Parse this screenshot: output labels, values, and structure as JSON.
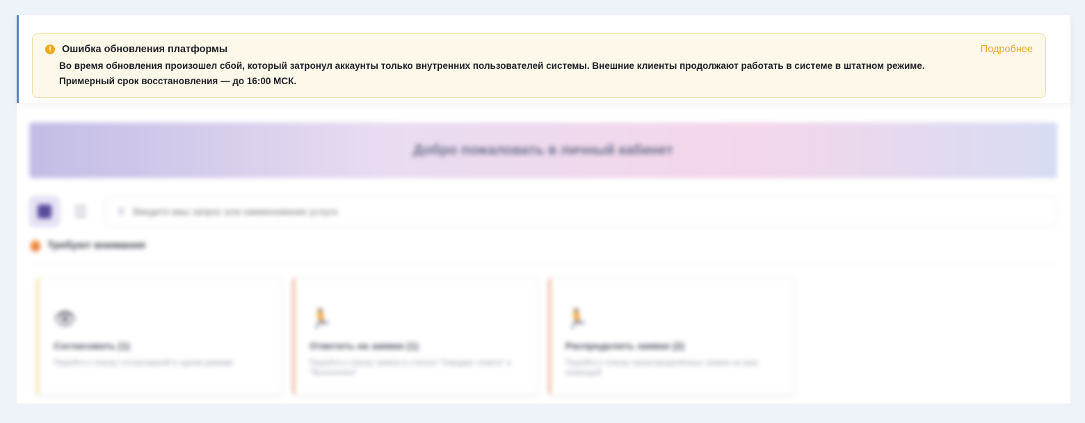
{
  "alert": {
    "title": "Ошибка обновления платформы",
    "more_link": "Подробнее",
    "line1": "Во время обновления произошел сбой, который затронул аккаунты только внутренних пользователей системы. Внешние клиенты продолжают работать в системе в штатном режиме.",
    "line2": "Примерный срок восстановления — до 16:00 МСК.",
    "icon": "warning-icon"
  },
  "hero": {
    "text": "Добро пожаловать в личный кабинет"
  },
  "search": {
    "placeholder": "Введите ваш запрос или наименование услуги"
  },
  "section": {
    "title": "Требуют внимания",
    "icon": "fire-icon"
  },
  "cards": [
    {
      "icon": "eye-icon",
      "glyph": "👁",
      "title": "Согласовать (1)",
      "desc": "Перейти к списку согласований в одном режиме"
    },
    {
      "icon": "runner-icon",
      "glyph": "🏃",
      "title": "Ответить на заявки (1)",
      "desc": "Перейти к списку заявок в статусе \"Ожидает ответа\" и \"Выполнено\""
    },
    {
      "icon": "runner-icon",
      "glyph": "🏃",
      "title": "Распределить заявки (2)",
      "desc": "Перейти к списку нераспределённых заявок на ваш командой"
    }
  ],
  "colors": {
    "accent": "#5a4b9e",
    "warning": "#f0a81c",
    "link": "#e8a52b",
    "alert_bg": "#fdf8e9"
  }
}
